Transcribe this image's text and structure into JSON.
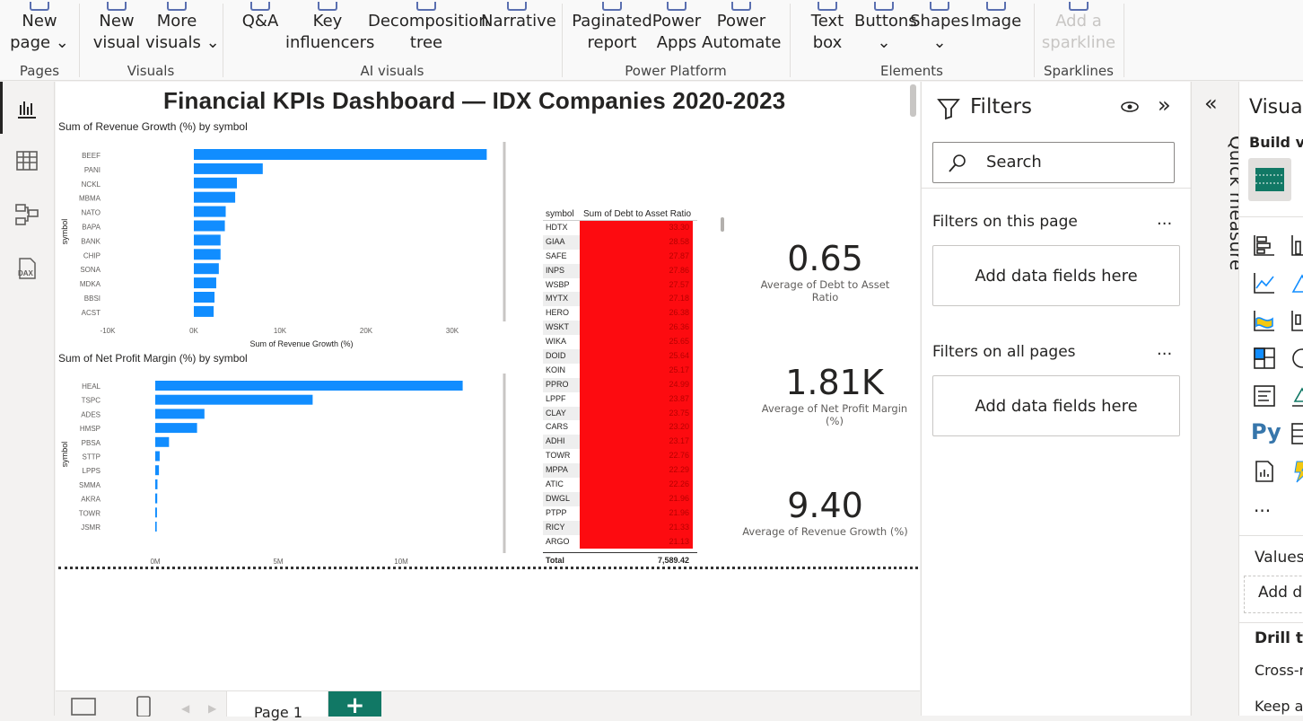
{
  "ribbon": {
    "buttons": [
      {
        "id": "new-page",
        "line1": "New",
        "line2": "page ⌄"
      },
      {
        "id": "new-visual",
        "line1": "New",
        "line2": "visual"
      },
      {
        "id": "more-visuals",
        "line1": "More",
        "line2": "visuals ⌄"
      },
      {
        "id": "qa",
        "line1": "Q&A",
        "line2": ""
      },
      {
        "id": "key-influencers",
        "line1": "Key",
        "line2": "influencers"
      },
      {
        "id": "decomposition-tree",
        "line1": "Decomposition",
        "line2": "tree"
      },
      {
        "id": "narrative",
        "line1": "Narrative",
        "line2": ""
      },
      {
        "id": "paginated-report",
        "line1": "Paginated",
        "line2": "report"
      },
      {
        "id": "power-apps",
        "line1": "Power",
        "line2": "Apps"
      },
      {
        "id": "power-automate",
        "line1": "Power",
        "line2": "Automate"
      },
      {
        "id": "text-box",
        "line1": "Text",
        "line2": "box"
      },
      {
        "id": "buttons",
        "line1": "Buttons",
        "line2": "⌄"
      },
      {
        "id": "shapes",
        "line1": "Shapes",
        "line2": "⌄"
      },
      {
        "id": "image",
        "line1": "Image",
        "line2": ""
      },
      {
        "id": "add-sparkline",
        "line1": "Add a",
        "line2": "sparkline"
      }
    ],
    "groups": [
      "Pages",
      "Visuals",
      "AI visuals",
      "Power Platform",
      "Elements",
      "Sparklines"
    ]
  },
  "report": {
    "title": "Financial KPIs Dashboard — IDX Companies 2020-2023",
    "chart1": {
      "title": "Sum of Revenue Growth (%) by symbol",
      "ylabel": "symbol",
      "xlabel": "Sum of Revenue Growth (%)"
    },
    "chart2": {
      "title": "Sum of Net Profit Margin (%) by symbol",
      "ylabel": "symbol",
      "xlabel": "Sum of Net Profit Margin (%)"
    },
    "table": {
      "col1": "symbol",
      "col2": "Sum of Debt to Asset Ratio",
      "total_label": "Total",
      "total_value": "7,589.42",
      "rows": [
        [
          "HDTX",
          "33.30"
        ],
        [
          "GIAA",
          "28.58"
        ],
        [
          "SAFE",
          "27.87"
        ],
        [
          "INPS",
          "27.86"
        ],
        [
          "WSBP",
          "27.57"
        ],
        [
          "MYTX",
          "27.18"
        ],
        [
          "HERO",
          "26.38"
        ],
        [
          "WSKT",
          "26.36"
        ],
        [
          "WIKA",
          "25.65"
        ],
        [
          "DOID",
          "25.64"
        ],
        [
          "KOIN",
          "25.17"
        ],
        [
          "PPRO",
          "24.99"
        ],
        [
          "LPPF",
          "23.87"
        ],
        [
          "CLAY",
          "23.75"
        ],
        [
          "CARS",
          "23.20"
        ],
        [
          "ADHI",
          "23.17"
        ],
        [
          "TOWR",
          "22.76"
        ],
        [
          "MPPA",
          "22.29"
        ],
        [
          "ATIC",
          "22.26"
        ],
        [
          "DWGL",
          "21.96"
        ],
        [
          "PTPP",
          "21.96"
        ],
        [
          "RICY",
          "21.33"
        ],
        [
          "ARGO",
          "21.13"
        ]
      ]
    },
    "cards": [
      {
        "value": "0.65",
        "label": "Average of Debt to Asset Ratio"
      },
      {
        "value": "1.81K",
        "label": "Average of Net Profit Margin (%)"
      },
      {
        "value": "9.40",
        "label": "Average of Revenue Growth (%)"
      }
    ]
  },
  "chart_data": [
    {
      "type": "bar",
      "title": "Sum of Revenue Growth (%) by symbol",
      "xlabel": "Sum of Revenue Growth (%)",
      "ylabel": "symbol",
      "categories": [
        "BEEF",
        "PANI",
        "NCKL",
        "MBMA",
        "NATO",
        "BAPA",
        "BANK",
        "CHIP",
        "SONA",
        "MDKA",
        "BBSI",
        "ACST"
      ],
      "values": [
        34000,
        8000,
        5000,
        4800,
        3700,
        3600,
        3100,
        3100,
        2900,
        2600,
        2400,
        2300
      ],
      "xlim": [
        -10000,
        35000
      ],
      "ticks": [
        "-10K",
        "0K",
        "10K",
        "20K",
        "30K"
      ],
      "tick_values": [
        -10000,
        0,
        10000,
        20000,
        30000
      ]
    },
    {
      "type": "bar",
      "title": "Sum of Net Profit Margin (%) by symbol",
      "xlabel": "Sum of Net Profit Margin (%)",
      "ylabel": "symbol",
      "categories": [
        "HEAL",
        "TSPC",
        "ADES",
        "HMSP",
        "PBSA",
        "STTP",
        "LPPS",
        "SMMA",
        "AKRA",
        "TOWR",
        "JSMR"
      ],
      "values": [
        12500000,
        6400000,
        2000000,
        1700000,
        560000,
        180000,
        150000,
        90000,
        80000,
        70000,
        60000
      ],
      "xlim": [
        0,
        13500000
      ],
      "ticks": [
        "0M",
        "5M",
        "10M"
      ],
      "tick_values": [
        0,
        5000000,
        10000000
      ]
    }
  ],
  "filters": {
    "title": "Filters",
    "search_placeholder": "Search",
    "this_page": "Filters on this page",
    "all_pages": "Filters on all pages",
    "add_fields": "Add data fields here",
    "more": "..."
  },
  "quick_measure": "Quick measure",
  "visualizations": {
    "title": "Visuali",
    "build": "Build vi",
    "values": "Values",
    "add_data": "Add da",
    "drill": "Drill th",
    "cross": "Cross-r",
    "keep": "Keep a",
    "more": "..."
  },
  "pages": {
    "page1": "Page 1"
  },
  "accent": "#118dff",
  "table_fill": "#fd0b10"
}
